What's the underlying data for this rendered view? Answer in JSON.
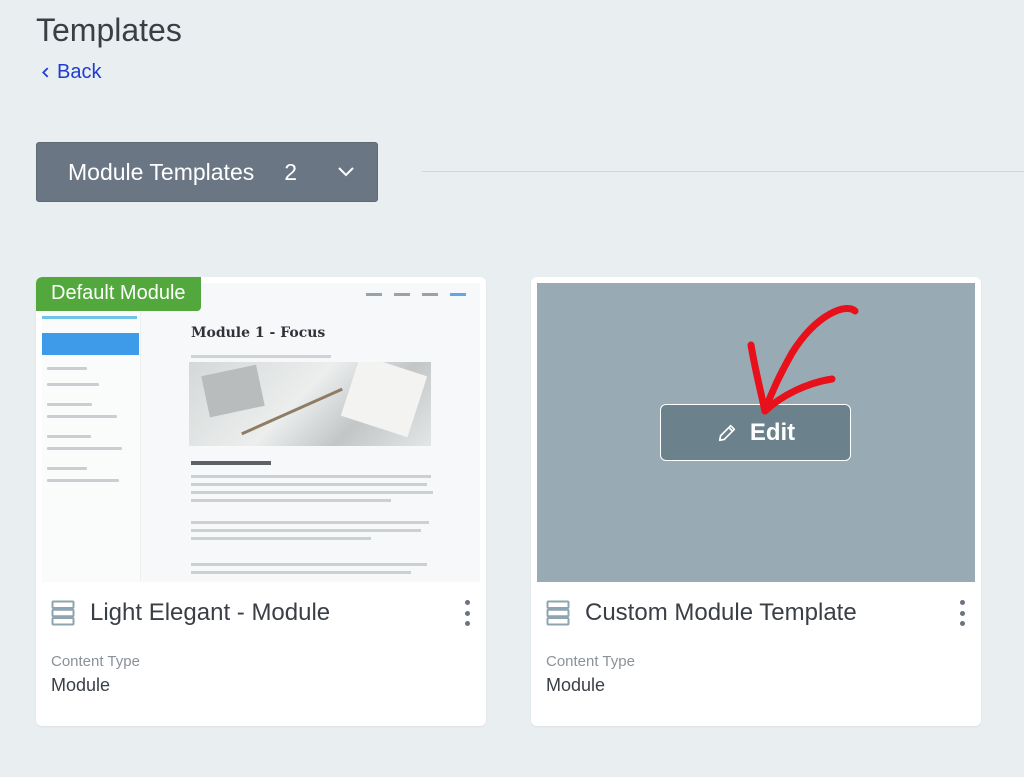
{
  "page": {
    "title": "Templates",
    "back_label": "Back"
  },
  "filter": {
    "label": "Module Templates",
    "count": "2"
  },
  "cards": [
    {
      "badge": "Default Module",
      "preview_heading": "Module 1 - Focus",
      "title": "Light Elegant - Module",
      "meta_label": "Content Type",
      "meta_value": "Module"
    },
    {
      "edit_label": "Edit",
      "title": "Custom Module Template",
      "meta_label": "Content Type",
      "meta_value": "Module"
    }
  ],
  "colors": {
    "background": "#e9eff0",
    "dropdown": "#6b7684",
    "badge": "#52a83c",
    "link": "#1f3bd0",
    "preview_placeholder": "#98aab3",
    "annotation_arrow": "#e8101a"
  },
  "icons": {
    "back": "chevron-left-icon",
    "dropdown": "chevron-down-icon",
    "template": "stack-icon",
    "menu": "kebab-menu-icon",
    "edit": "pencil-icon"
  }
}
